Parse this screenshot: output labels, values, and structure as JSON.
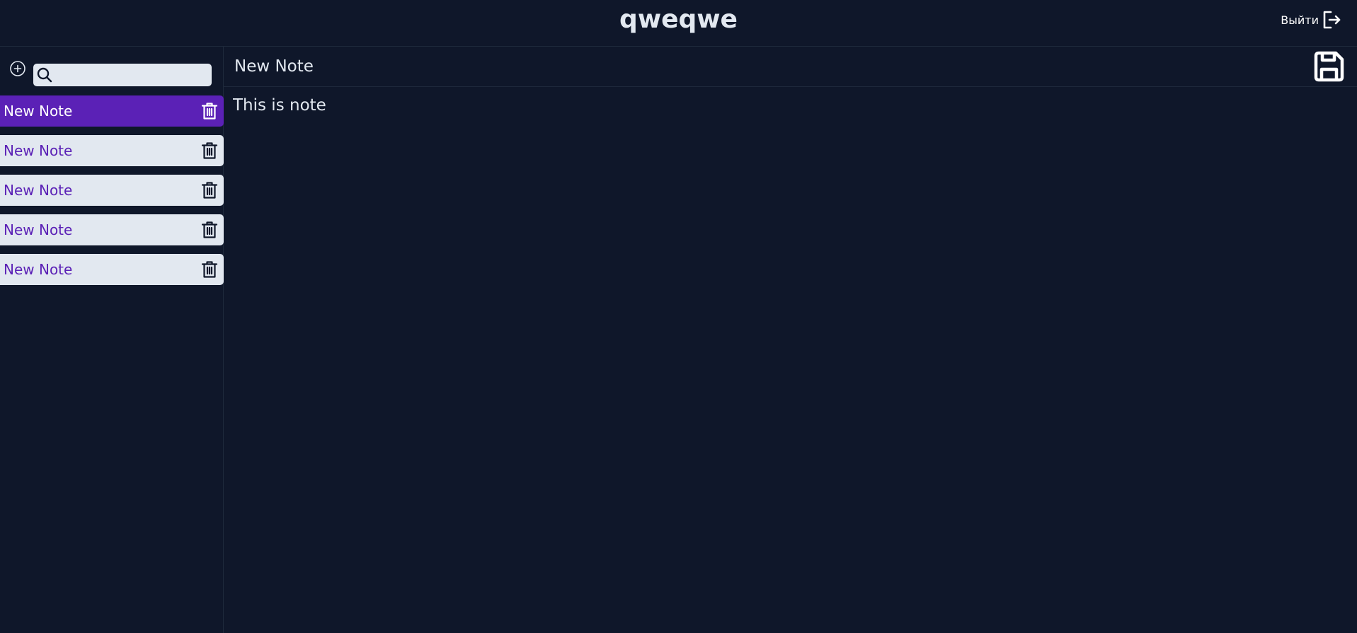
{
  "header": {
    "title": "qweqwe",
    "logout_label": "Выйти"
  },
  "sidebar": {
    "search": {
      "placeholder": "",
      "value": ""
    },
    "notes": [
      {
        "title": "New Note",
        "active": true
      },
      {
        "title": "New Note",
        "active": false
      },
      {
        "title": "New Note",
        "active": false
      },
      {
        "title": "New Note",
        "active": false
      },
      {
        "title": "New Note",
        "active": false
      }
    ]
  },
  "editor": {
    "title": "New Note",
    "body": "This is note"
  },
  "colors": {
    "background": "#0f172a",
    "accent": "#5b21b6",
    "item_background": "#e2e8f0",
    "text": "#e2e8f0"
  },
  "icons": {
    "add": "plus-circle-icon",
    "search": "search-icon",
    "delete": "trash-icon",
    "save": "floppy-disk-icon",
    "logout": "logout-icon"
  }
}
